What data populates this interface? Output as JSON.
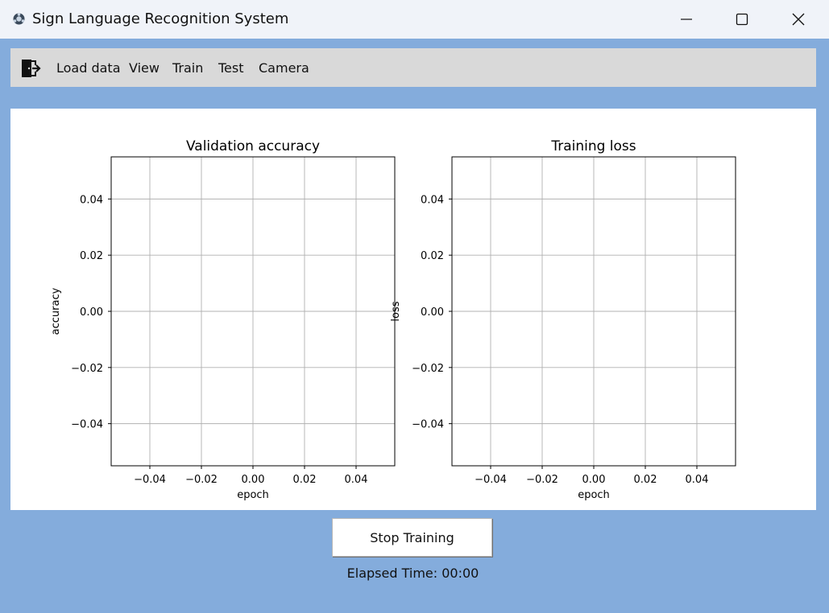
{
  "window": {
    "title": "Sign Language Recognition System",
    "icon": "app-icon",
    "controls": [
      "minimize-icon",
      "maximize-icon",
      "close-icon"
    ]
  },
  "menu": {
    "exit_icon": "exit-door-icon",
    "items": [
      {
        "label": "Load data"
      },
      {
        "label": "View"
      },
      {
        "label": "Train"
      },
      {
        "label": "Test"
      },
      {
        "label": "Camera"
      }
    ]
  },
  "chart_data": [
    {
      "type": "line",
      "title": "Validation accuracy",
      "xlabel": "epoch",
      "ylabel": "accuracy",
      "xlim": [
        -0.055,
        0.055
      ],
      "ylim": [
        -0.055,
        0.055
      ],
      "xticks": [
        -0.04,
        -0.02,
        0.0,
        0.02,
        0.04
      ],
      "yticks": [
        0.04,
        0.02,
        0.0,
        -0.02,
        -0.04
      ],
      "xtick_labels": [
        "−0.04",
        "−0.02",
        "0.00",
        "0.02",
        "0.04"
      ],
      "ytick_labels": [
        "0.04",
        "0.02",
        "0.00",
        "−0.02",
        "−0.04"
      ],
      "grid": true,
      "series": []
    },
    {
      "type": "line",
      "title": "Training loss",
      "xlabel": "epoch",
      "ylabel": "loss",
      "xlim": [
        -0.055,
        0.055
      ],
      "ylim": [
        -0.055,
        0.055
      ],
      "xticks": [
        -0.04,
        -0.02,
        0.0,
        0.02,
        0.04
      ],
      "yticks": [
        0.04,
        0.02,
        0.0,
        -0.02,
        -0.04
      ],
      "xtick_labels": [
        "−0.04",
        "−0.02",
        "0.00",
        "0.02",
        "0.04"
      ],
      "ytick_labels": [
        "0.04",
        "0.02",
        "0.00",
        "−0.02",
        "−0.04"
      ],
      "grid": true,
      "series": []
    }
  ],
  "controls": {
    "stop_label": "Stop Training",
    "elapsed_label": "Elapsed Time:",
    "elapsed_value": "00:00"
  }
}
